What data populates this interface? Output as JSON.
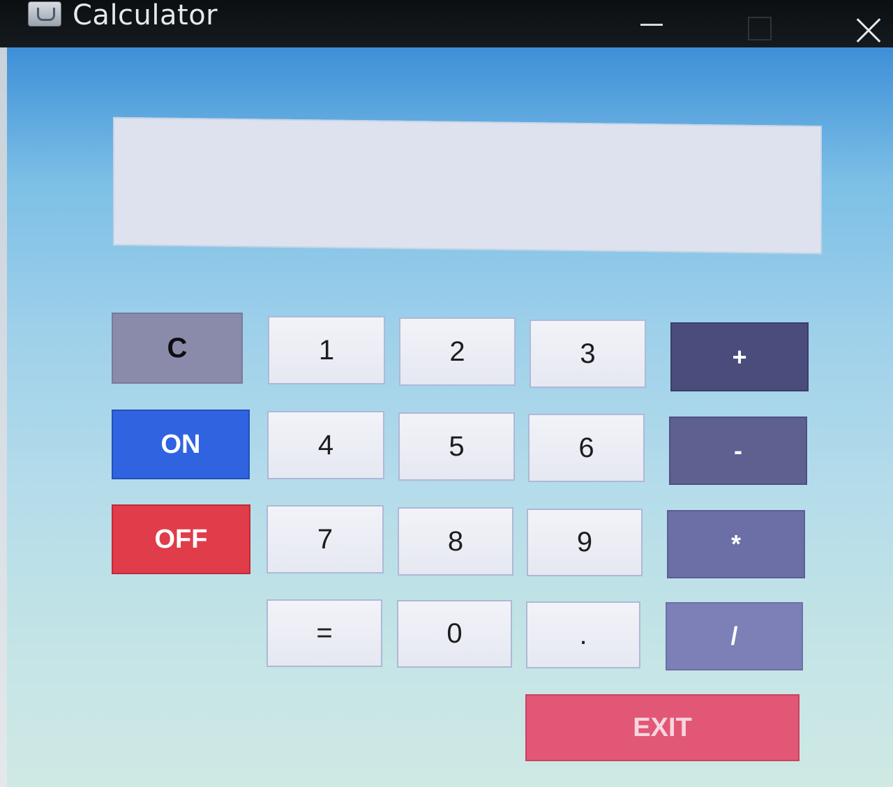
{
  "window": {
    "title": "Calculator",
    "icon": "java-coffee-icon"
  },
  "display": {
    "value": ""
  },
  "buttons": {
    "clear": "C",
    "on": "ON",
    "off": "OFF",
    "one": "1",
    "two": "2",
    "three": "3",
    "four": "4",
    "five": "5",
    "six": "6",
    "seven": "7",
    "eight": "8",
    "nine": "9",
    "equals": "=",
    "zero": "0",
    "dot": ".",
    "plus": "+",
    "minus": "-",
    "multiply": "*",
    "divide": "/",
    "exit": "EXIT"
  },
  "colors": {
    "on": "#2f63e0",
    "off": "#e03c4a",
    "exit": "#e25776",
    "operator": "#4a4d7c",
    "background_top": "#3e8fd8",
    "background_bottom": "#cfe9e4"
  }
}
